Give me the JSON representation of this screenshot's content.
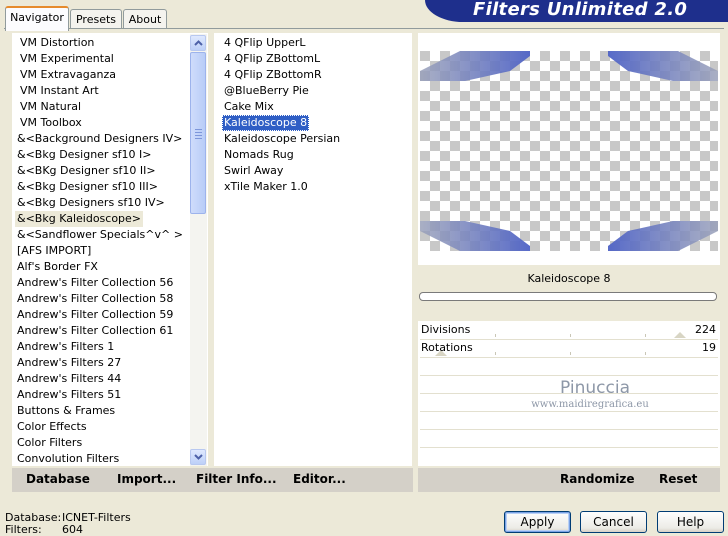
{
  "tabs": [
    "Navigator",
    "Presets",
    "About"
  ],
  "title": "Filters Unlimited 2.0",
  "categories": [
    "VM Distortion",
    "VM Experimental",
    "VM Extravaganza",
    "VM Instant Art",
    "VM Natural",
    "VM Toolbox",
    "&<Background Designers IV>",
    "&<Bkg Designer sf10 I>",
    "&<BKg Designer sf10 II>",
    "&<Bkg Designer sf10 III>",
    "&<Bkg Designers sf10 IV>",
    "&<Bkg Kaleidoscope>",
    "&<Sandflower Specials^v^ >",
    "[AFS IMPORT]",
    "Alf's Border FX",
    "Andrew's Filter Collection 56",
    "Andrew's Filter Collection 58",
    "Andrew's Filter Collection 59",
    "Andrew's Filter Collection 61",
    "Andrew's Filters 1",
    "Andrew's Filters 27",
    "Andrew's Filters 44",
    "Andrew's Filters 51",
    "Buttons & Frames",
    "Color Effects",
    "Color Filters",
    "Convolution Filters"
  ],
  "selected_category": "&<Bkg Kaleidoscope>",
  "filters": [
    "4 QFlip UpperL",
    "4 QFlip ZBottomL",
    "4 QFlip ZBottomR",
    "@BlueBerry Pie",
    "Cake Mix",
    "Kaleidoscope 8",
    "Kaleidoscope Persian",
    "Nomads Rug",
    "Swirl Away",
    "xTile Maker 1.0"
  ],
  "selected_filter": "Kaleidoscope 8",
  "preview": {
    "filter_name": "Kaleidoscope 8",
    "progress": 0
  },
  "params": [
    {
      "label": "Divisions",
      "value": "224",
      "level": 0.88
    },
    {
      "label": "Rotations",
      "value": "19",
      "level": 0.07
    }
  ],
  "watermark": {
    "line1": "Pinuccia",
    "line2": "www.maidiregrafica.eu"
  },
  "actions": [
    "Database",
    "Import...",
    "Filter Info...",
    "Editor..."
  ],
  "preview_actions": [
    "Randomize",
    "Reset"
  ],
  "status": {
    "database_label": "Database:",
    "database_value": "ICNET-Filters",
    "filters_label": "Filters:",
    "filters_value": "604"
  },
  "buttons": [
    "Apply",
    "Cancel",
    "Help"
  ],
  "colors": {
    "banner": "#1e2f8c",
    "selection": "#2f5ec5",
    "shape": "#8a93bd"
  }
}
